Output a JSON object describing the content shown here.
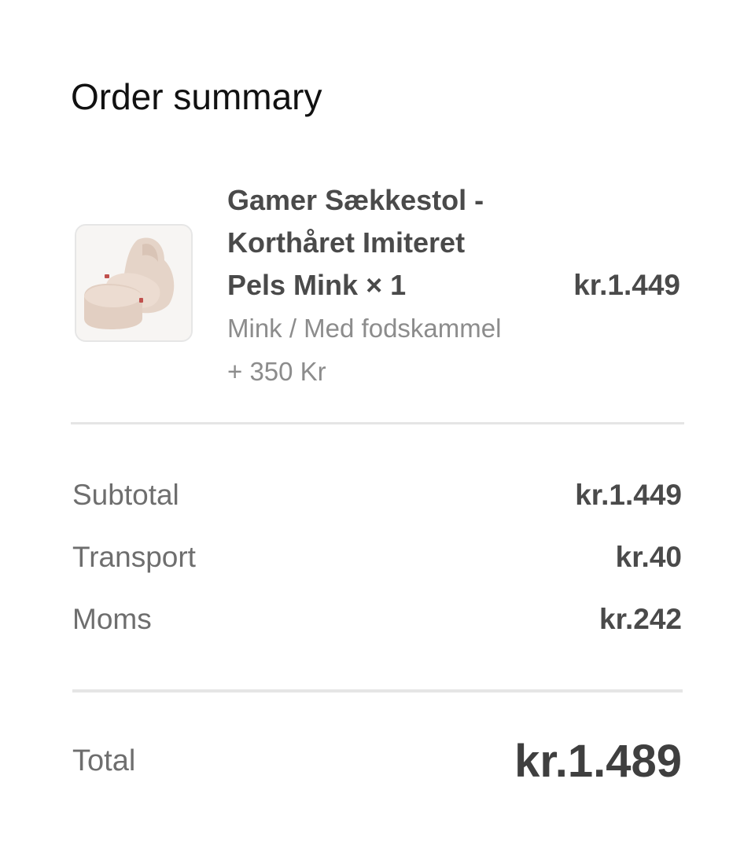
{
  "order_summary": {
    "heading": "Order summary",
    "item": {
      "title_lines": [
        "Gamer Sækkestol -",
        "Korthåret Imiteret",
        "Pels Mink × 1"
      ],
      "variant": "Mink / Med fodskammel",
      "addon": "+ 350 Kr",
      "price": "kr.1.449",
      "thumbnail_icon": "bean-bag-chair-image"
    },
    "totals": {
      "subtotal_label": "Subtotal",
      "subtotal_value": "kr.1.449",
      "transport_label": "Transport",
      "transport_value": "kr.40",
      "moms_label": "Moms",
      "moms_value": "kr.242",
      "total_label": "Total",
      "total_value": "kr.1.489"
    }
  }
}
